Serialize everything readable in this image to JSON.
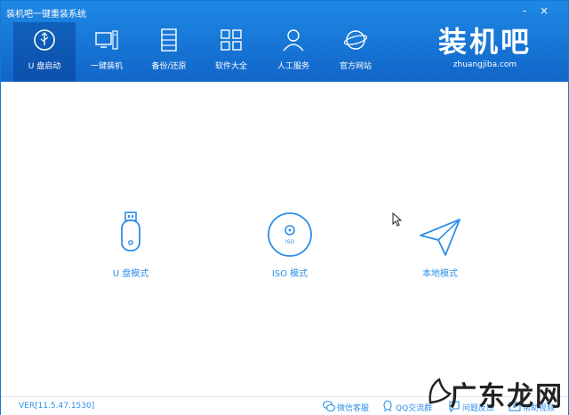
{
  "window": {
    "title": "装机吧一键重装系统",
    "controls": [
      "-",
      "×"
    ]
  },
  "nav": {
    "items": [
      {
        "label": "U 盘启动",
        "icon": "usb-icon",
        "active": true
      },
      {
        "label": "一键装机",
        "icon": "computer-icon",
        "active": false
      },
      {
        "label": "备份/还原",
        "icon": "backup-icon",
        "active": false
      },
      {
        "label": "软件大全",
        "icon": "apps-grid-icon",
        "active": false
      },
      {
        "label": "人工服务",
        "icon": "person-icon",
        "active": false
      },
      {
        "label": "官方网站",
        "icon": "globe-icon",
        "active": false
      }
    ]
  },
  "logo": {
    "text": "装机吧",
    "sub": "zhuangjiba.com"
  },
  "modes": [
    {
      "label": "U 盘模式",
      "icon": "usb-drive-icon"
    },
    {
      "label": "ISO 模式",
      "icon": "disc-icon",
      "disc_text": "ISO"
    },
    {
      "label": "本地模式",
      "icon": "paper-plane-icon"
    }
  ],
  "footer": {
    "version": "VER[11.5.47.1530]",
    "links": [
      {
        "label": "微信客服",
        "icon": "wechat-icon"
      },
      {
        "label": "QQ交流群",
        "icon": "qq-icon"
      },
      {
        "label": "问题反馈",
        "icon": "feedback-icon"
      },
      {
        "label": "帮助视频",
        "icon": "video-icon"
      }
    ]
  },
  "watermark": {
    "text": "广东龙网"
  },
  "colors": {
    "header": "#1b7ad8",
    "accent": "#2c8ee8"
  }
}
